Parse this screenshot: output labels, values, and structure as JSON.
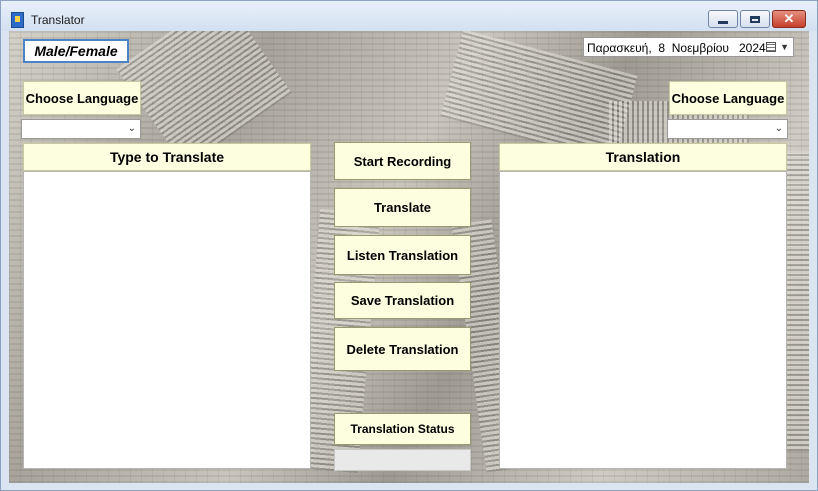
{
  "window": {
    "title": "Translator",
    "controls": {
      "minimize": "minimize-icon",
      "maximize": "maximize-icon",
      "close": "close-icon"
    }
  },
  "gender_toggle": {
    "label": "Male/Female"
  },
  "date_picker": {
    "day_name": "Παρασκευή,",
    "day": "8",
    "month": "Νοεμβρίου",
    "year": "2024"
  },
  "source": {
    "choose_language_label": "Choose Language",
    "language_value": "",
    "panel_title": "Type to Translate",
    "text": ""
  },
  "target": {
    "choose_language_label": "Choose Language",
    "language_value": "",
    "panel_title": "Translation",
    "text": ""
  },
  "actions": {
    "start_recording": "Start Recording",
    "translate": "Translate",
    "listen_translation": "Listen Translation",
    "save_translation": "Save Translation",
    "delete_translation": "Delete Translation"
  },
  "status": {
    "label": "Translation Status",
    "value": ""
  },
  "colors": {
    "label_bg": "#fdfde0",
    "accent_border": "#4c83c7",
    "close_red": "#c3412b"
  }
}
